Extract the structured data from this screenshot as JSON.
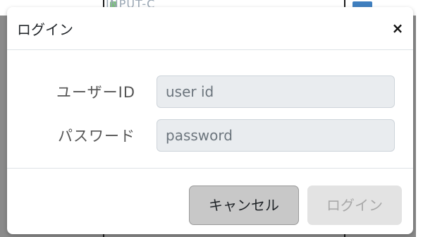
{
  "background": {
    "partial_text": "INPUT-C"
  },
  "modal": {
    "title": "ログイン",
    "close_glyph": "×",
    "fields": [
      {
        "label": "ユーザーID",
        "placeholder": "user id",
        "value": ""
      },
      {
        "label": "パスワード",
        "placeholder": "password",
        "value": ""
      }
    ],
    "buttons": {
      "cancel_label": "キャンセル",
      "login_label": "ログイン",
      "login_enabled": false
    }
  },
  "colors": {
    "input_bg": "#e9ecef",
    "cancel_bg": "#c8c8c8",
    "login_disabled_bg": "#e3e3e3",
    "overlay": "#8a8a8a"
  }
}
